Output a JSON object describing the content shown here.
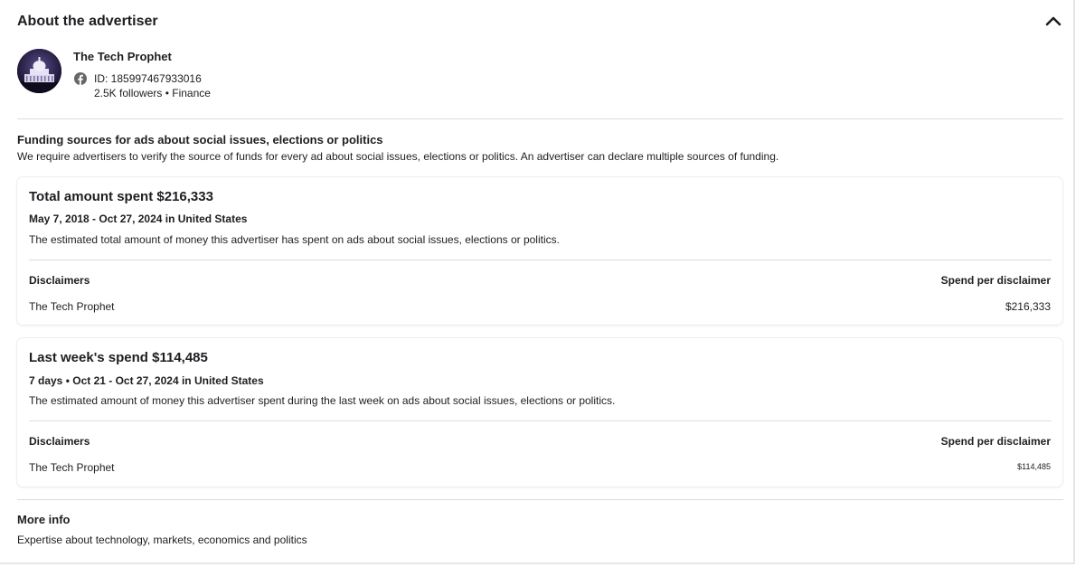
{
  "header": {
    "title": "About the advertiser"
  },
  "advertiser": {
    "name": "The Tech Prophet",
    "id_text": "ID: 185997467933016",
    "meta": "2.5K followers • Finance"
  },
  "funding": {
    "title": "Funding sources for ads about social issues, elections or politics",
    "description": "We require advertisers to verify the source of funds for every ad about social issues, elections or politics. An advertiser can declare multiple sources of funding."
  },
  "total_card": {
    "title": "Total amount spent $216,333",
    "range": "May 7, 2018 - Oct 27, 2024 in United States",
    "description": "The estimated total amount of money this advertiser has spent on ads about social issues, elections or politics.",
    "col_left": "Disclaimers",
    "col_right": "Spend per disclaimer",
    "row_name": "The Tech Prophet",
    "row_value": "$216,333"
  },
  "week_card": {
    "title": "Last week's spend $114,485",
    "range": "7 days • Oct 21 - Oct 27, 2024 in United States",
    "description": "The estimated amount of money this advertiser spent during the last week on ads about social issues, elections or politics.",
    "col_left": "Disclaimers",
    "col_right": "Spend per disclaimer",
    "row_name": "The Tech Prophet",
    "row_value": "$114,485"
  },
  "more_info": {
    "title": "More info",
    "description": "Expertise about technology, markets, economics and politics"
  },
  "icons": {
    "collapse": "chevron-up-icon",
    "platform": "facebook-icon",
    "avatar": "capitol-building-image"
  },
  "colors": {
    "facebook_icon": "#65676b",
    "avatar_bg": "#1f1836"
  }
}
